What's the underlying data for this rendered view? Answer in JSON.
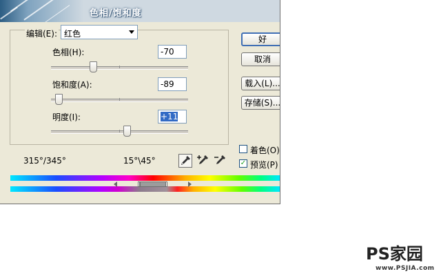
{
  "window": {
    "title": "色相/饱和度"
  },
  "edit": {
    "label": "编辑(E):",
    "selected": "红色"
  },
  "hue": {
    "label": "色相(H):",
    "value": "-70",
    "slider_fraction": 0.306
  },
  "saturation": {
    "label": "饱和度(A):",
    "value": "-89",
    "slider_fraction": 0.055
  },
  "lightness": {
    "label": "明度(I):",
    "value": "+11",
    "slider_fraction": 0.555
  },
  "buttons": {
    "ok": "好",
    "cancel": "取消",
    "load": "载入(L)...",
    "save": "存储(S)..."
  },
  "options": {
    "colorize_label": "着色(O)",
    "colorize_checked": false,
    "preview_label": "预览(P)",
    "preview_checked": true
  },
  "ranges": {
    "left": "315°/345°",
    "right": "15°\\45°"
  },
  "icons": [
    "eyedropper-icon",
    "eyedropper-plus-icon",
    "eyedropper-minus-icon"
  ],
  "watermark": {
    "text": "PS家园",
    "url": "www.PSJIA.com"
  }
}
